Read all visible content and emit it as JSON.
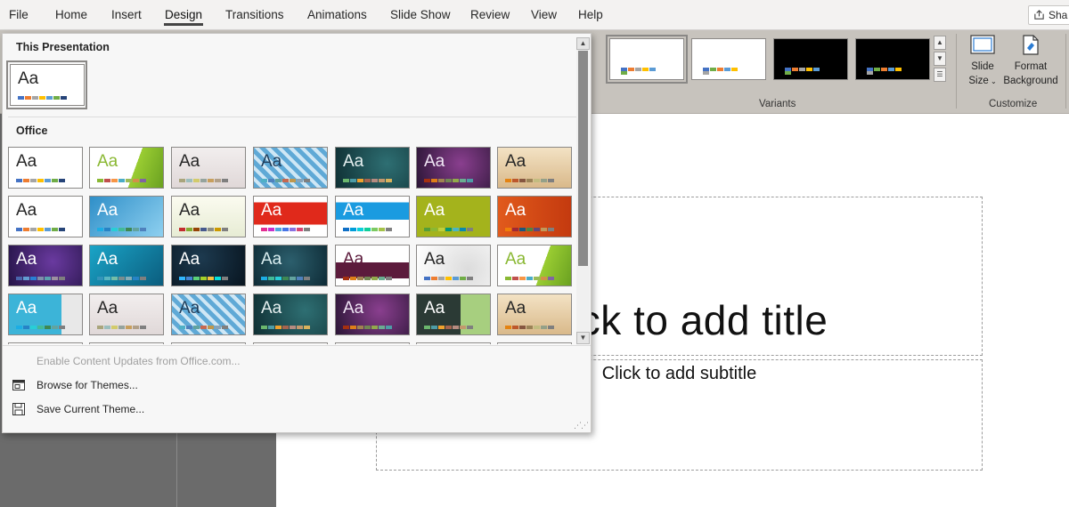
{
  "menu": {
    "tabs": [
      "File",
      "Home",
      "Insert",
      "Design",
      "Transitions",
      "Animations",
      "Slide Show",
      "Review",
      "View",
      "Help"
    ],
    "active_tab": "Design",
    "share_label": "Sha"
  },
  "ribbon": {
    "variants_label": "Variants",
    "customize_label": "Customize",
    "slide_size_label_1": "Slide",
    "slide_size_label_2": "Size",
    "format_background_label_1": "Format",
    "format_background_label_2": "Background",
    "variants": [
      {
        "bg": "#ffffff",
        "colors": [
          "#4472c4",
          "#ed7d31",
          "#a5a5a5",
          "#ffc000",
          "#5b9bd5",
          "#70ad47"
        ]
      },
      {
        "bg": "#ffffff",
        "colors": [
          "#4472c4",
          "#70ad47",
          "#ed7d31",
          "#5b9bd5",
          "#ffc000",
          "#a5a5a5"
        ]
      },
      {
        "bg": "#000000",
        "colors": [
          "#4472c4",
          "#ed7d31",
          "#a5a5a5",
          "#ffc000",
          "#5b9bd5",
          "#70ad47"
        ]
      },
      {
        "bg": "#000000",
        "colors": [
          "#4472c4",
          "#70ad47",
          "#ed7d31",
          "#5b9bd5",
          "#ffc000",
          "#a5a5a5"
        ]
      }
    ]
  },
  "slide": {
    "title_placeholder": "Click to add title",
    "subtitle_placeholder": "Click to add subtitle"
  },
  "dropdown": {
    "this_presentation_heading": "This Presentation",
    "office_heading": "Office",
    "sample_text": "Aa",
    "commands": {
      "enable_updates": "Enable Content Updates from Office.com...",
      "browse_themes": "Browse for Themes...",
      "save_theme": "Save Current Theme..."
    },
    "current_theme": {
      "bg": "#ffffff",
      "text": "#262626",
      "colors": [
        "#4472c4",
        "#ed7d31",
        "#a5a5a5",
        "#ffc000",
        "#5b9bd5",
        "#70ad47",
        "#264478"
      ]
    },
    "themes": [
      {
        "bg": "#ffffff",
        "text": "#262626",
        "colors": [
          "#4472c4",
          "#ed7d31",
          "#a5a5a5",
          "#ffc000",
          "#5b9bd5",
          "#70ad47",
          "#264478"
        ]
      },
      {
        "bg": "linear-gradient(110deg,#ffffff 60%,#9acd32 60%,#6aa121 100%)",
        "text": "#8ab833",
        "colors": [
          "#8ab833",
          "#c0504d",
          "#f79646",
          "#4bacc6",
          "#9bbb59",
          "#d19049",
          "#8064a2"
        ]
      },
      {
        "bg": "linear-gradient(180deg,#f2eeee,#e0d8d8)",
        "text": "#262626",
        "colors": [
          "#a9a57c",
          "#9cbebd",
          "#d2cb6c",
          "#95a39d",
          "#c89f5d",
          "#b1a089",
          "#7f7f7f"
        ]
      },
      {
        "bg": "repeating-linear-gradient(45deg,#5fa9d6 0 5px,#cfe7f5 5px 9px)",
        "text": "#1f3d5a",
        "colors": [
          "#4fb0c6",
          "#4f81bd",
          "#62a39f",
          "#c66951",
          "#bf974d",
          "#87a3b8",
          "#7f7f7f"
        ]
      },
      {
        "bg": "radial-gradient(circle at 70% 40%,#2e6f73,#0f2f33)",
        "text": "#e6f0f0",
        "colors": [
          "#6bb76d",
          "#4e9ca6",
          "#f0a22e",
          "#a5644e",
          "#b58b80",
          "#c3986d",
          "#d8b25c"
        ]
      },
      {
        "bg": "radial-gradient(circle at 60% 40%,#8a3f8f,#2a1535)",
        "text": "#f0e6f5",
        "colors": [
          "#a53010",
          "#de7e18",
          "#9f8351",
          "#728653",
          "#92aa4c",
          "#6aac91",
          "#4e9ca6"
        ]
      },
      {
        "bg": "linear-gradient(180deg,#f3e2c4,#d9b98a)",
        "text": "#262626",
        "colors": [
          "#e48312",
          "#bd582c",
          "#865640",
          "#9b8357",
          "#c2bc80",
          "#94a088",
          "#7f7f7f"
        ]
      },
      {
        "bg": "#ffffff",
        "text": "#262626",
        "colors": [
          "#4472c4",
          "#ed7d31",
          "#a5a5a5",
          "#ffc000",
          "#5b9bd5",
          "#70ad47",
          "#264478"
        ]
      },
      {
        "bg": "linear-gradient(135deg,#2f8fc8,#8ed0f0)",
        "text": "#ffffff",
        "colors": [
          "#1cade4",
          "#2683c6",
          "#27ced7",
          "#42ba97",
          "#3e8853",
          "#62a39f",
          "#4f81bd"
        ]
      },
      {
        "bg": "linear-gradient(180deg,#fbfbf0,#e7ecd4)",
        "text": "#262626",
        "colors": [
          "#c32d2e",
          "#84aa33",
          "#964305",
          "#475a8d",
          "#8c8d86",
          "#cc9900",
          "#7f7f7f"
        ]
      },
      {
        "bg": "linear-gradient(180deg,#ffffff 0,#ffffff 14%,#e0291b 14%,#e0291b 70%,#ffffff 70%)",
        "text": "#ffffff",
        "colors": [
          "#e32d91",
          "#c830cc",
          "#4ea6dc",
          "#4775e7",
          "#8971e1",
          "#d54773",
          "#7f7f7f"
        ]
      },
      {
        "bg": "linear-gradient(180deg,#ffffff 0,#ffffff 14%,#1a9be0 14%,#1a9be0 58%,#ffffff 58%)",
        "text": "#ffffff",
        "colors": [
          "#0f6fc6",
          "#009dd9",
          "#0bd0d9",
          "#10cf9b",
          "#7cca62",
          "#a5c249",
          "#7f7f7f"
        ]
      },
      {
        "bg": "#a4b31c",
        "text": "#ffffff",
        "colors": [
          "#549e39",
          "#8ab833",
          "#c0cf3a",
          "#029676",
          "#4ab5c4",
          "#0989b1",
          "#7f7f7f"
        ]
      },
      {
        "bg": "linear-gradient(90deg,#e15a1c,#c43a0f)",
        "text": "#ffffff",
        "colors": [
          "#f07f09",
          "#9f2936",
          "#1b587c",
          "#4e8542",
          "#604878",
          "#c19859",
          "#7f7f7f"
        ]
      },
      {
        "bg": "radial-gradient(circle at 60% 40%,#6a3aa0,#251447)",
        "text": "#ffffff",
        "colors": [
          "#4a66ac",
          "#629dd1",
          "#297fd5",
          "#7f8fa9",
          "#5aa2ae",
          "#9d90a0",
          "#7f7f7f"
        ]
      },
      {
        "bg": "linear-gradient(135deg,#1aa4c7,#0b5d7e)",
        "text": "#ffffff",
        "colors": [
          "#3494ba",
          "#58b6c0",
          "#75bda7",
          "#7a8c8e",
          "#84acb6",
          "#2683c6",
          "#7f7f7f"
        ]
      },
      {
        "bg": "radial-gradient(circle at 40% 30%,#1d3a4f,#081520)",
        "text": "#ffffff",
        "colors": [
          "#31b6fd",
          "#4584d3",
          "#5bd078",
          "#a5d028",
          "#f5c040",
          "#05e0db",
          "#7f7f7f"
        ]
      },
      {
        "bg": "radial-gradient(circle at 50% 40%,#2c5f6d,#0e2b36)",
        "text": "#d9eef0",
        "colors": [
          "#1cade4",
          "#42ba97",
          "#27ced7",
          "#3e8853",
          "#62a39f",
          "#4f81bd",
          "#7f7f7f"
        ]
      },
      {
        "bg": "linear-gradient(180deg,#ffffff 0,#ffffff 42%,#5c1b3c 42%,#5c1b3c 82%,#ffffff 82%)",
        "text": "#5c1b3c",
        "colors": [
          "#a53010",
          "#de7e18",
          "#9f8351",
          "#728653",
          "#92aa4c",
          "#6aac91",
          "#7f7f7f"
        ]
      },
      {
        "bg": "radial-gradient(circle at 70% 60%,#dcdcdc,#ffffff)",
        "text": "#262626",
        "colors": [
          "#4472c4",
          "#ed7d31",
          "#a5a5a5",
          "#ffc000",
          "#5b9bd5",
          "#70ad47",
          "#7f7f7f"
        ]
      },
      {
        "bg": "linear-gradient(110deg,#ffffff 60%,#9acd32 60%,#6aa121 100%)",
        "text": "#8ab833",
        "colors": [
          "#8ab833",
          "#c0504d",
          "#f79646",
          "#4bacc6",
          "#9bbb59",
          "#d19049",
          "#8064a2"
        ]
      },
      {
        "bg": "linear-gradient(90deg,#3cb4d8 0,#3cb4d8 72%,#e8e8e8 72%)",
        "text": "#ffffff",
        "colors": [
          "#1cade4",
          "#2683c6",
          "#27ced7",
          "#42ba97",
          "#3e8853",
          "#62a39f",
          "#7f7f7f"
        ]
      },
      {
        "bg": "linear-gradient(180deg,#f2eeee,#e0d8d8)",
        "text": "#262626",
        "colors": [
          "#a9a57c",
          "#9cbebd",
          "#d2cb6c",
          "#95a39d",
          "#c89f5d",
          "#b1a089",
          "#7f7f7f"
        ]
      },
      {
        "bg": "repeating-linear-gradient(45deg,#5fa9d6 0 5px,#cfe7f5 5px 9px)",
        "text": "#1f3d5a",
        "colors": [
          "#4fb0c6",
          "#4f81bd",
          "#62a39f",
          "#c66951",
          "#bf974d",
          "#87a3b8",
          "#7f7f7f"
        ]
      },
      {
        "bg": "radial-gradient(circle at 70% 40%,#2e6f73,#0f2f33)",
        "text": "#e6f0f0",
        "colors": [
          "#6bb76d",
          "#4e9ca6",
          "#f0a22e",
          "#a5644e",
          "#b58b80",
          "#c3986d",
          "#d8b25c"
        ]
      },
      {
        "bg": "radial-gradient(circle at 60% 40%,#8a3f8f,#2a1535)",
        "text": "#f0e6f5",
        "colors": [
          "#a53010",
          "#de7e18",
          "#9f8351",
          "#728653",
          "#92aa4c",
          "#6aac91",
          "#4e9ca6"
        ]
      },
      {
        "bg": "linear-gradient(90deg,#2b3a35 0,#2b3a35 60%,#a7cf7f 60%)",
        "text": "#ffffff",
        "colors": [
          "#6bb76d",
          "#4e9ca6",
          "#f0a22e",
          "#a5644e",
          "#b58b80",
          "#c3986d",
          "#7f7f7f"
        ]
      },
      {
        "bg": "linear-gradient(180deg,#f3e2c4,#d9b98a)",
        "text": "#262626",
        "colors": [
          "#e48312",
          "#bd582c",
          "#865640",
          "#9b8357",
          "#c2bc80",
          "#94a088",
          "#7f7f7f"
        ]
      },
      {
        "bg": "linear-gradient(180deg,#ffffff 0,#ffffff 50%,#c42f2f 50%)",
        "text": "#262626",
        "colors": []
      },
      {
        "bg": "linear-gradient(180deg,#ffffff 0,#ffffff 50%,#505050 50%)",
        "text": "#262626",
        "colors": []
      },
      {
        "bg": "linear-gradient(180deg,#ffffff 0,#ffffff 50%,#8cc3d9 50%)",
        "text": "#262626",
        "colors": []
      },
      {
        "bg": "#ffffff",
        "text": "#262626",
        "colors": []
      },
      {
        "bg": "linear-gradient(180deg,#ffffff 0,#ffffff 50%,#a6a6a6 50%)",
        "text": "#262626",
        "colors": []
      },
      {
        "bg": "#ffffff",
        "text": "#262626",
        "colors": []
      },
      {
        "bg": "linear-gradient(180deg,#ffffff 0,#ffffff 50%,#45b8c8 50%)",
        "text": "#262626",
        "colors": []
      }
    ]
  }
}
